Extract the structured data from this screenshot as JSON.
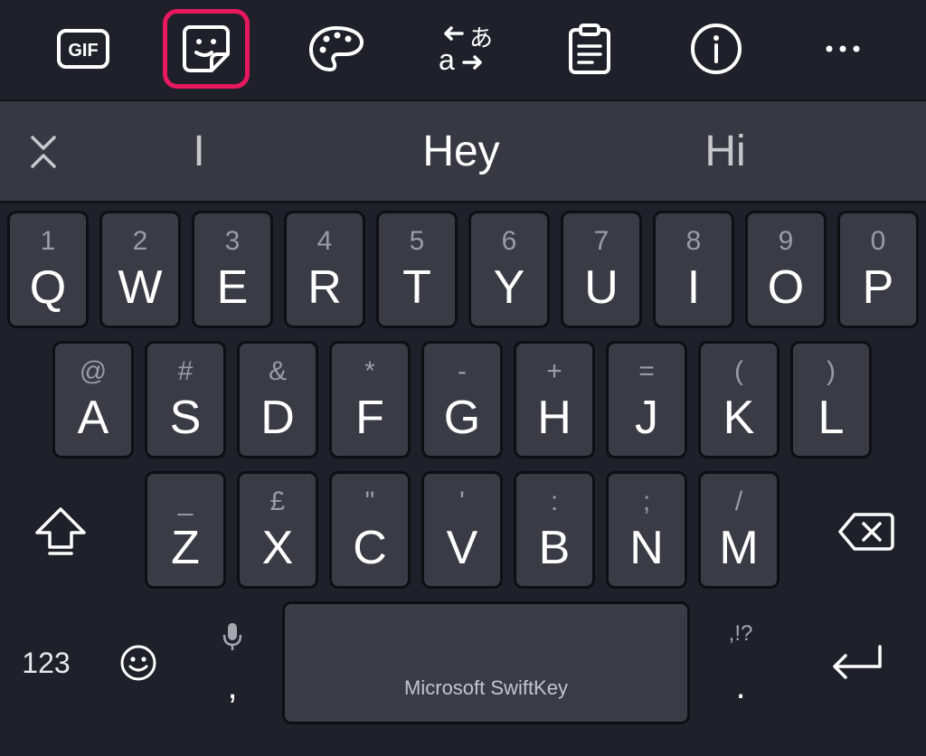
{
  "toolbar": {
    "gif_label": "GIF",
    "items": [
      {
        "name": "gif-button",
        "icon": "gif-icon"
      },
      {
        "name": "stickers-button",
        "icon": "sticker-icon",
        "selected": true
      },
      {
        "name": "themes-button",
        "icon": "palette-icon"
      },
      {
        "name": "translator-button",
        "icon": "translate-icon"
      },
      {
        "name": "clipboard-button",
        "icon": "clipboard-icon"
      },
      {
        "name": "info-button",
        "icon": "info-icon"
      },
      {
        "name": "more-button",
        "icon": "more-icon"
      }
    ],
    "accent_color": "#e8185e"
  },
  "suggestions": {
    "left": "I",
    "center": "Hey",
    "right": "Hi"
  },
  "keys": {
    "row1": [
      {
        "hint": "1",
        "label": "Q"
      },
      {
        "hint": "2",
        "label": "W"
      },
      {
        "hint": "3",
        "label": "E"
      },
      {
        "hint": "4",
        "label": "R"
      },
      {
        "hint": "5",
        "label": "T"
      },
      {
        "hint": "6",
        "label": "Y"
      },
      {
        "hint": "7",
        "label": "U"
      },
      {
        "hint": "8",
        "label": "I"
      },
      {
        "hint": "9",
        "label": "O"
      },
      {
        "hint": "0",
        "label": "P"
      }
    ],
    "row2": [
      {
        "hint": "@",
        "label": "A"
      },
      {
        "hint": "#",
        "label": "S"
      },
      {
        "hint": "&",
        "label": "D"
      },
      {
        "hint": "*",
        "label": "F"
      },
      {
        "hint": "-",
        "label": "G"
      },
      {
        "hint": "+",
        "label": "H"
      },
      {
        "hint": "=",
        "label": "J"
      },
      {
        "hint": "(",
        "label": "K"
      },
      {
        "hint": ")",
        "label": "L"
      }
    ],
    "row3": [
      {
        "hint": "_",
        "label": "Z"
      },
      {
        "hint": "£",
        "label": "X"
      },
      {
        "hint": "\"",
        "label": "C"
      },
      {
        "hint": "'",
        "label": "V"
      },
      {
        "hint": ":",
        "label": "B"
      },
      {
        "hint": ";",
        "label": "N"
      },
      {
        "hint": "/",
        "label": "M"
      }
    ]
  },
  "bottom": {
    "numbers_label": "123",
    "comma": ",",
    "space_label": "Microsoft SwiftKey",
    "period": ".",
    "period_hint": ",!?"
  },
  "colors": {
    "background": "#1f202a",
    "key": "#3a3b45",
    "suggestion_bar": "#373842"
  }
}
